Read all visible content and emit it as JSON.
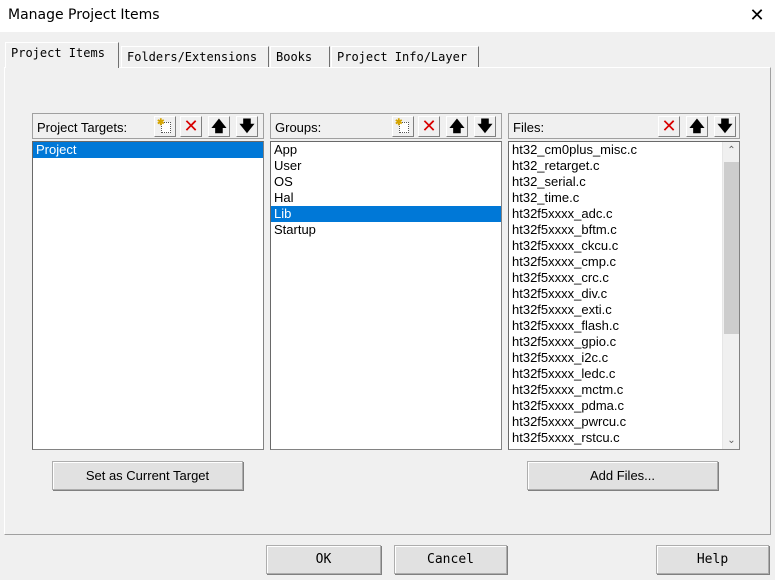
{
  "window": {
    "title": "Manage Project Items",
    "close_glyph": "✕"
  },
  "tabs": [
    {
      "label": "Project Items",
      "active": true
    },
    {
      "label": "Folders/Extensions",
      "active": false
    },
    {
      "label": "Books",
      "active": false
    },
    {
      "label": "Project Info/Layer",
      "active": false
    }
  ],
  "targets": {
    "label": "Project Targets:",
    "items": [
      {
        "label": "Project",
        "selected": true
      }
    ],
    "set_current_label": "Set as Current Target"
  },
  "groups": {
    "label": "Groups:",
    "items": [
      {
        "label": "App",
        "selected": false
      },
      {
        "label": "User",
        "selected": false
      },
      {
        "label": "OS",
        "selected": false
      },
      {
        "label": "Hal",
        "selected": false
      },
      {
        "label": "Lib",
        "selected": true
      },
      {
        "label": "Startup",
        "selected": false
      }
    ]
  },
  "files": {
    "label": "Files:",
    "items": [
      "ht32_cm0plus_misc.c",
      "ht32_retarget.c",
      "ht32_serial.c",
      "ht32_time.c",
      "ht32f5xxxx_adc.c",
      "ht32f5xxxx_bftm.c",
      "ht32f5xxxx_ckcu.c",
      "ht32f5xxxx_cmp.c",
      "ht32f5xxxx_crc.c",
      "ht32f5xxxx_div.c",
      "ht32f5xxxx_exti.c",
      "ht32f5xxxx_flash.c",
      "ht32f5xxxx_gpio.c",
      "ht32f5xxxx_i2c.c",
      "ht32f5xxxx_ledc.c",
      "ht32f5xxxx_mctm.c",
      "ht32f5xxxx_pdma.c",
      "ht32f5xxxx_pwrcu.c",
      "ht32f5xxxx_rstcu.c"
    ],
    "add_files_label": "Add Files..."
  },
  "icons": {
    "new": "new-item-icon",
    "delete": "delete-x-icon",
    "up": "move-up-arrow-icon",
    "down": "move-down-arrow-icon",
    "delete_glyph": "✕",
    "up_glyph": "🡅",
    "down_glyph": "🡇",
    "scroll_up_glyph": "⌃",
    "scroll_down_glyph": "⌄"
  },
  "buttons": {
    "ok": "OK",
    "cancel": "Cancel",
    "help": "Help"
  },
  "colors": {
    "selection": "#0078d7",
    "delete": "#d80000",
    "dialog_bg": "#f0f0f0"
  }
}
